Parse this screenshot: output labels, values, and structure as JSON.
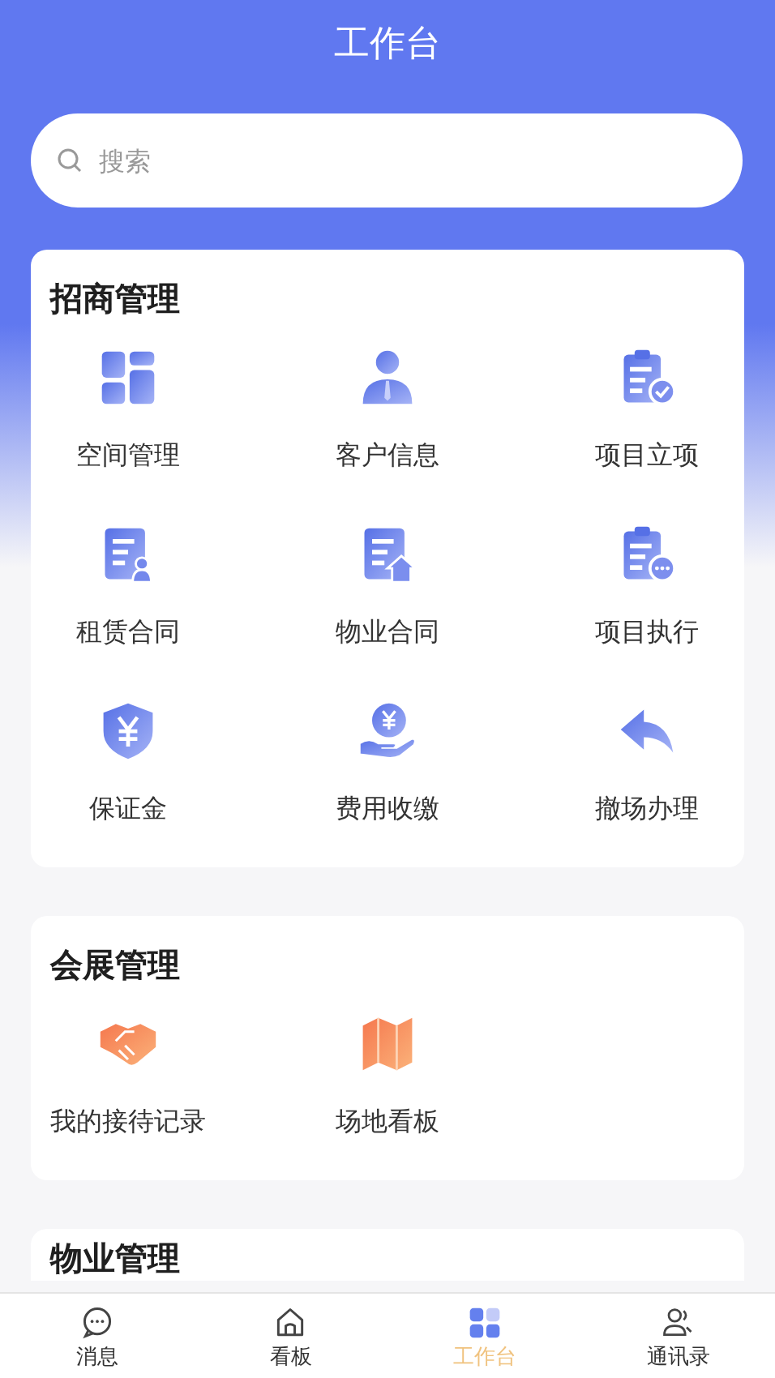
{
  "header": {
    "title": "工作台"
  },
  "search": {
    "placeholder": "搜索"
  },
  "sections": [
    {
      "title": "招商管理",
      "items": [
        {
          "label": "空间管理"
        },
        {
          "label": "客户信息"
        },
        {
          "label": "项目立项"
        },
        {
          "label": "租赁合同"
        },
        {
          "label": "物业合同"
        },
        {
          "label": "项目执行"
        },
        {
          "label": "保证金"
        },
        {
          "label": "费用收缴"
        },
        {
          "label": "撤场办理"
        }
      ]
    },
    {
      "title": "会展管理",
      "items": [
        {
          "label": "我的接待记录"
        },
        {
          "label": "场地看板"
        }
      ]
    },
    {
      "title": "物业管理"
    }
  ],
  "tabs": [
    {
      "label": "消息",
      "selected": false
    },
    {
      "label": "看板",
      "selected": false
    },
    {
      "label": "工作台",
      "selected": true
    },
    {
      "label": "通讯录",
      "selected": false
    }
  ]
}
